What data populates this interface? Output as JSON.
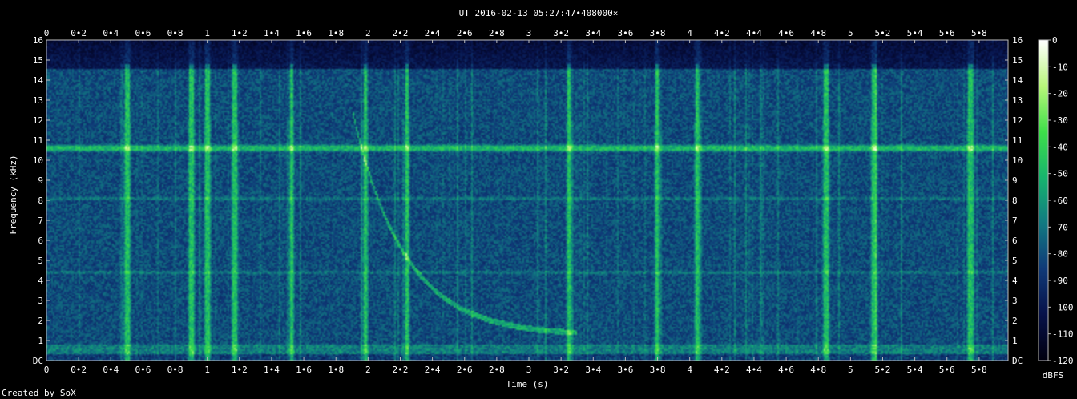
{
  "chart_data": {
    "type": "heatmap",
    "title": "UT 2016-02-13 05:27:47•408000×",
    "xlabel": "Time (s)",
    "ylabel": "Frequency (kHz)",
    "x_ticks": [
      "0",
      "0•2",
      "0•4",
      "0•6",
      "0•8",
      "1",
      "1•2",
      "1•4",
      "1•6",
      "1•8",
      "2",
      "2•2",
      "2•4",
      "2•6",
      "2•8",
      "3",
      "3•2",
      "3•4",
      "3•6",
      "3•8",
      "4",
      "4•2",
      "4•4",
      "4•6",
      "4•8",
      "5",
      "5•2",
      "5•4",
      "5•6",
      "5•8"
    ],
    "y_ticks": [
      "DC",
      "1",
      "2",
      "3",
      "4",
      "5",
      "6",
      "7",
      "8",
      "9",
      "10",
      "11",
      "12",
      "13",
      "14",
      "15",
      "16"
    ],
    "xlim": [
      0,
      5.98
    ],
    "ylim": [
      0,
      16
    ],
    "colorbar": {
      "label": "dBFS",
      "ticks": [
        "0",
        "-10",
        "-20",
        "-30",
        "-40",
        "-50",
        "-60",
        "-70",
        "-80",
        "-90",
        "-100",
        "-110",
        "-120"
      ],
      "range": [
        -120,
        0
      ]
    },
    "colormap": [
      "#000010",
      "#07124a",
      "#0f3a78",
      "#117a82",
      "#17b56e",
      "#3ee04a",
      "#b8f67a",
      "#ffffff"
    ],
    "features": {
      "steady_tone_khz": 10.6,
      "weak_tones_khz": [
        8.1,
        4.4
      ],
      "whistler_sweep": {
        "start_time_s": 1.9,
        "start_khz": 12.5,
        "end_time_s": 3.3,
        "end_khz": 1.2
      },
      "sferic_times_s": [
        0.5,
        0.9,
        1.0,
        1.17,
        1.52,
        1.98,
        2.24,
        3.25,
        3.8,
        4.05,
        4.85,
        5.15,
        5.75
      ]
    }
  },
  "footer": "Created by SoX"
}
